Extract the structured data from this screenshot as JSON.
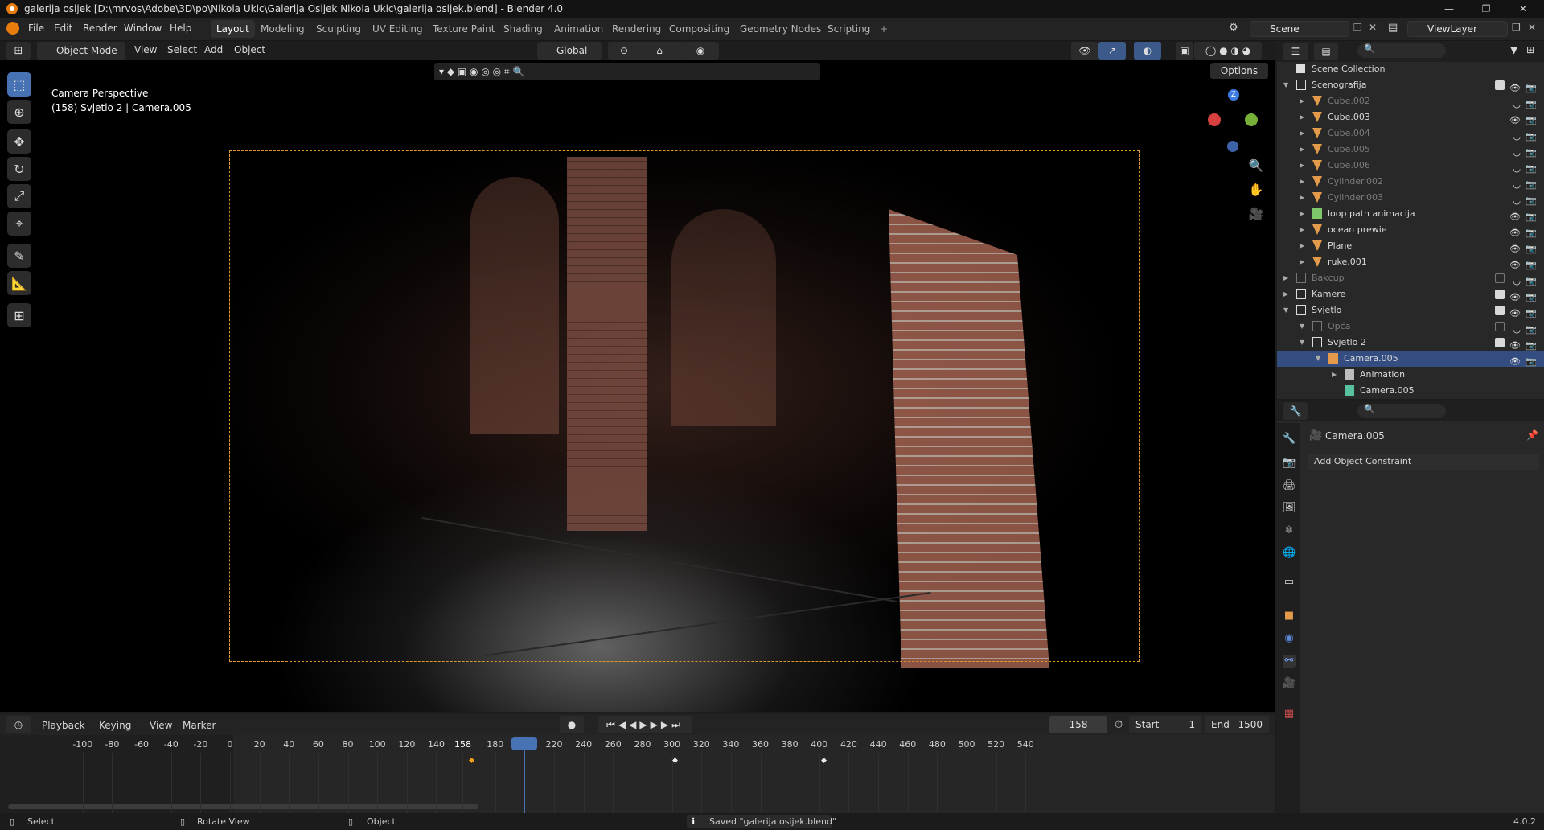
{
  "window": {
    "title": "galerija osijek [D:\\mrvos\\Adobe\\3D\\po\\Nikola Ukic\\Galerija Osijek Nikola Ukic\\galerija osijek.blend] - Blender 4.0",
    "min": "—",
    "max": "❐",
    "close": "✕"
  },
  "menu": [
    "File",
    "Edit",
    "Render",
    "Window",
    "Help"
  ],
  "workspaces": [
    "Layout",
    "Modeling",
    "Sculpting",
    "UV Editing",
    "Texture Paint",
    "Shading",
    "Animation",
    "Rendering",
    "Compositing",
    "Geometry Nodes",
    "Scripting",
    "+"
  ],
  "active_workspace": "Layout",
  "scene_field": "Scene",
  "viewlayer_field": "ViewLayer",
  "viewport_header": {
    "mode": "Object Mode",
    "menus": [
      "View",
      "Select",
      "Add",
      "Object"
    ],
    "orientation": "Global",
    "options": "Options"
  },
  "viewport": {
    "label": "Camera Perspective",
    "info": "(158) Svjetlo 2 | Camera.005",
    "gizmo_z": "Z"
  },
  "outliner": {
    "root": "Scene Collection",
    "rows": [
      {
        "label": "Scenografija",
        "type": "collection",
        "level": 0,
        "check": true,
        "dim": false
      },
      {
        "label": "Cube.002",
        "type": "mesh",
        "level": 1,
        "dim": true
      },
      {
        "label": "Cube.003",
        "type": "mesh",
        "level": 1,
        "dim": false
      },
      {
        "label": "Cube.004",
        "type": "mesh",
        "level": 1,
        "dim": true
      },
      {
        "label": "Cube.005",
        "type": "mesh",
        "level": 1,
        "dim": true
      },
      {
        "label": "Cube.006",
        "type": "mesh",
        "level": 1,
        "dim": true
      },
      {
        "label": "Cylinder.002",
        "type": "mesh",
        "level": 1,
        "dim": true
      },
      {
        "label": "Cylinder.003",
        "type": "mesh",
        "level": 1,
        "dim": true
      },
      {
        "label": "loop path animacija",
        "type": "curve",
        "level": 1,
        "dim": false
      },
      {
        "label": "ocean prewie",
        "type": "mesh",
        "level": 1,
        "dim": false
      },
      {
        "label": "Plane",
        "type": "mesh",
        "level": 1,
        "dim": false
      },
      {
        "label": "ruke.001",
        "type": "mesh",
        "level": 1,
        "dim": false
      },
      {
        "label": "Bakcup",
        "type": "collection",
        "level": 0,
        "check": false,
        "dim": true
      },
      {
        "label": "Kamere",
        "type": "collection",
        "level": 0,
        "check": true,
        "dim": false
      },
      {
        "label": "Svjetlo",
        "type": "collection",
        "level": 0,
        "check": true,
        "dim": false
      },
      {
        "label": "Opća",
        "type": "collection",
        "level": 1,
        "check": false,
        "dim": true
      },
      {
        "label": "Svjetlo 2",
        "type": "collection",
        "level": 1,
        "check": true,
        "dim": false
      },
      {
        "label": "Camera.005",
        "type": "camera",
        "level": 2,
        "dim": false,
        "selected": true
      },
      {
        "label": "Animation",
        "type": "anim",
        "level": 3,
        "dim": false
      },
      {
        "label": "Camera.005",
        "type": "cameradata",
        "level": 3,
        "dim": false
      }
    ]
  },
  "properties": {
    "object_name": "Camera.005",
    "add_constraint": "Add Object Constraint"
  },
  "timeline": {
    "menus": [
      "Playback",
      "Keying",
      "View",
      "Marker"
    ],
    "current_frame": "158",
    "start_label": "Start",
    "start": "1",
    "end_label": "End",
    "end": "1500",
    "ticks": [
      "-100",
      "-80",
      "-60",
      "-40",
      "-20",
      "0",
      "20",
      "40",
      "60",
      "80",
      "100",
      "120",
      "140",
      "158",
      "180",
      "200",
      "220",
      "240",
      "260",
      "280",
      "300",
      "320",
      "340",
      "360",
      "380",
      "400",
      "420",
      "440",
      "460",
      "480",
      "500",
      "520",
      "540"
    ],
    "keyframes": [
      158,
      296,
      397
    ]
  },
  "status": {
    "select": "Select",
    "rotate": "Rotate View",
    "object": "Object",
    "message": "Saved \"galerija osijek.blend\"",
    "version": "4.0.2"
  },
  "colors": {
    "accent": "#4772b3",
    "selection": "#334d80",
    "camera_frame": "#e09a2a",
    "keyframe_active": "#f0a020"
  }
}
